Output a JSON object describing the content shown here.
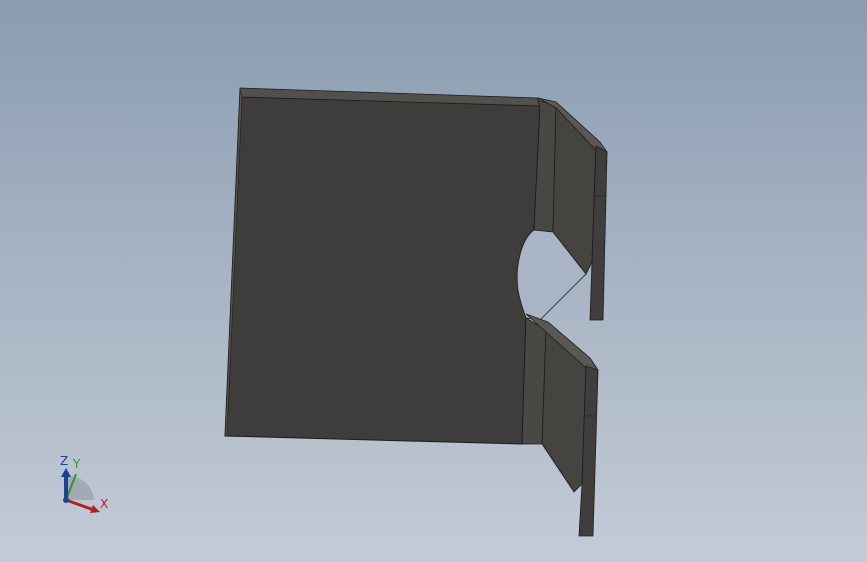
{
  "viewport": {
    "background_top": "#8a9cb1",
    "background_bottom": "#c3cbd6"
  },
  "model": {
    "part_color": "#3f3d3b",
    "edge_color": "#1c1b1a"
  },
  "triad": {
    "x_label": "X",
    "y_label": "Y",
    "z_label": "Z",
    "x_color": "#b22020",
    "y_color": "#2e9a2e",
    "z_color": "#1f3f9a"
  }
}
